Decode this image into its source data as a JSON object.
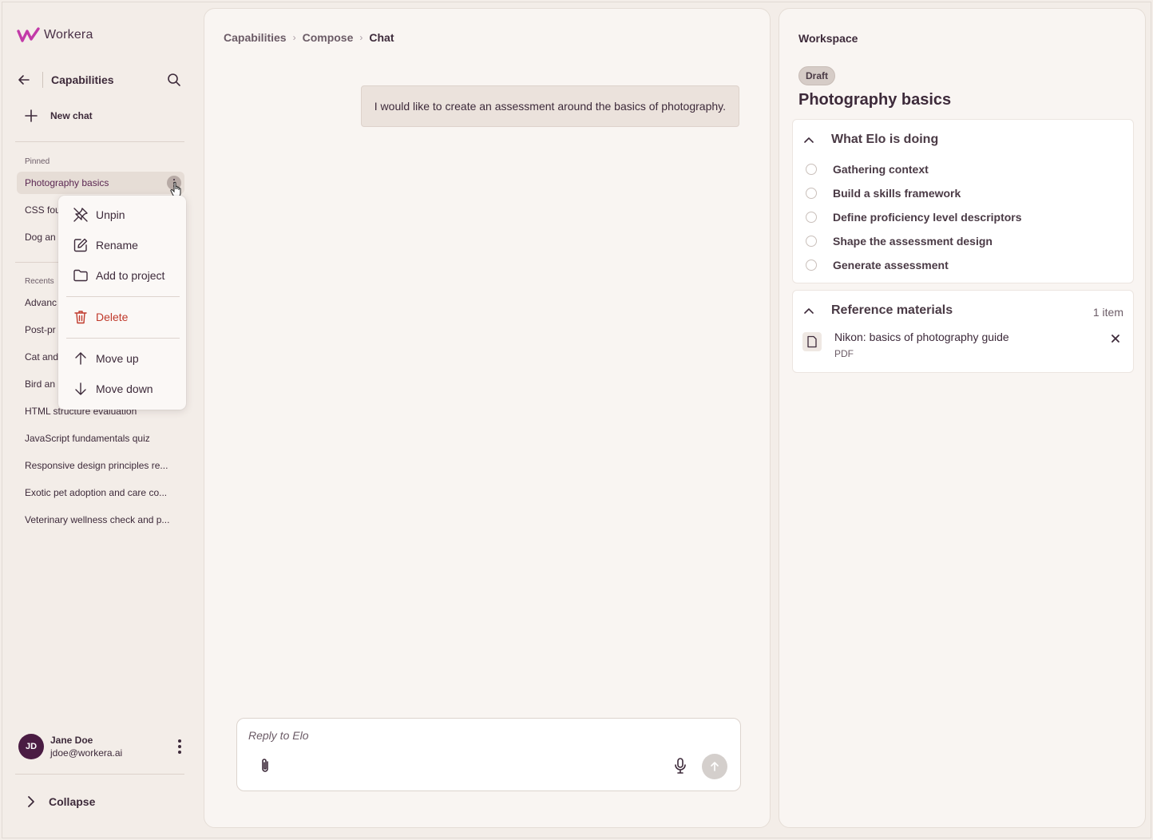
{
  "brand": {
    "name": "Workera",
    "accent": "#c23aa8"
  },
  "sidebar": {
    "section_title": "Capabilities",
    "new_chat_label": "New chat",
    "pinned_label": "Pinned",
    "pinned": [
      {
        "label": "Photography basics"
      },
      {
        "label": "CSS fou"
      },
      {
        "label": "Dog an"
      }
    ],
    "recents_label": "Recents",
    "recents": [
      {
        "label": "Advanc"
      },
      {
        "label": "Post-pr"
      },
      {
        "label": "Cat and"
      },
      {
        "label": "Bird an"
      },
      {
        "label": "HTML structure evaluation"
      },
      {
        "label": "JavaScript fundamentals quiz"
      },
      {
        "label": "Responsive design principles re..."
      },
      {
        "label": "Exotic pet adoption and care co..."
      },
      {
        "label": "Veterinary wellness check and p..."
      }
    ],
    "user": {
      "initials": "JD",
      "name": "Jane Doe",
      "email": "jdoe@workera.ai"
    },
    "collapse_label": "Collapse"
  },
  "context_menu": {
    "items": [
      {
        "label": "Unpin",
        "icon": "unpin-icon"
      },
      {
        "label": "Rename",
        "icon": "pencil-icon"
      },
      {
        "label": "Add to project",
        "icon": "folder-icon"
      },
      {
        "label": "Delete",
        "icon": "trash-icon"
      },
      {
        "label": "Move up",
        "icon": "arrow-up-icon"
      },
      {
        "label": "Move down",
        "icon": "arrow-down-icon"
      }
    ]
  },
  "main": {
    "breadcrumb": [
      "Capabilities",
      "Compose",
      "Chat"
    ],
    "user_message": "I would like to create an assessment around the basics of photography.",
    "composer": {
      "placeholder": "Reply to Elo"
    }
  },
  "workspace": {
    "title": "Workspace",
    "status_badge": "Draft",
    "heading": "Photography basics",
    "activity": {
      "title": "What Elo is doing",
      "tasks": [
        "Gathering context",
        "Build a skills framework",
        "Define proficiency level descriptors",
        "Shape the assessment design",
        "Generate assessment"
      ]
    },
    "references": {
      "title": "Reference materials",
      "count": "1 item",
      "files": [
        {
          "name": "Nikon: basics of photography guide",
          "type": "PDF"
        }
      ]
    }
  }
}
